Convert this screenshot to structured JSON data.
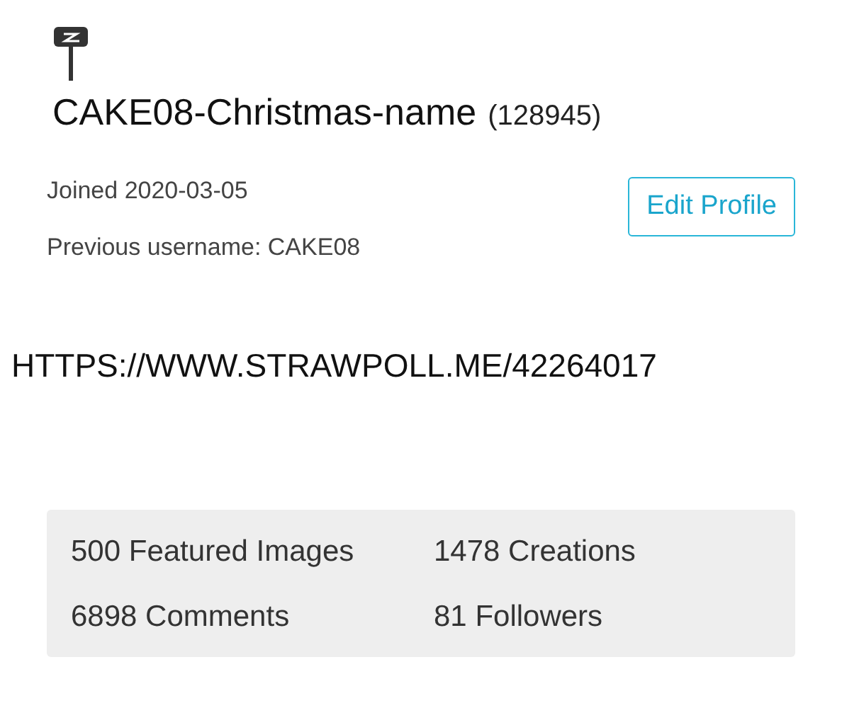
{
  "profile": {
    "username": "CAKE08-Christmas-name",
    "points": "(128945)",
    "joined": "Joined 2020-03-05",
    "previous": "Previous username: CAKE08",
    "edit_button": "Edit Profile"
  },
  "link": "HTTPS://WWW.STRAWPOLL.ME/42264017",
  "stats": [
    {
      "label": "500 Featured Images"
    },
    {
      "label": "1478 Creations"
    },
    {
      "label": "6898 Comments"
    },
    {
      "label": "81 Followers"
    }
  ]
}
